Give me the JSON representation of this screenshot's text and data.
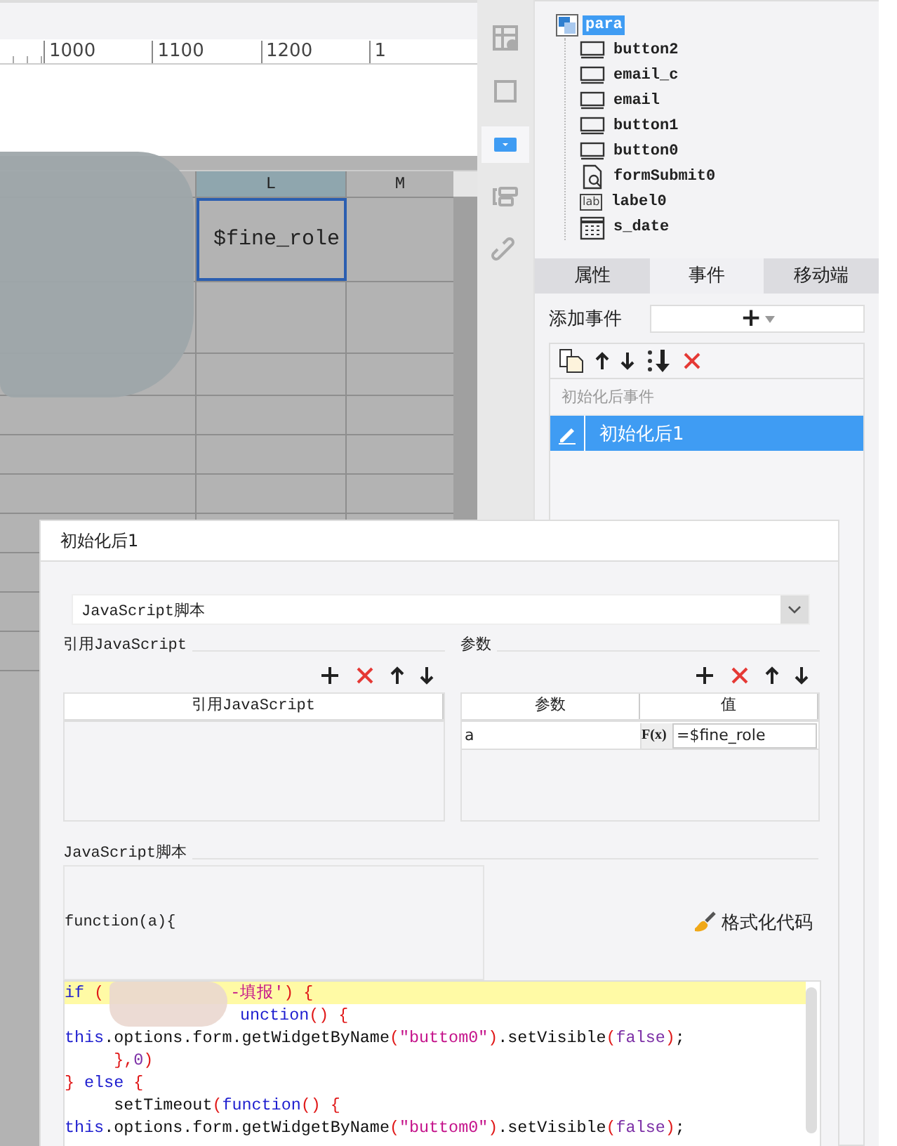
{
  "canvas": {
    "ruler_labels": [
      "1000",
      "1100",
      "1200",
      "1"
    ],
    "columns": [
      {
        "label": "L",
        "selected": true
      },
      {
        "label": "M",
        "selected": false
      }
    ],
    "cell_text": "$fine_role"
  },
  "tools": [
    {
      "kind": "table-info",
      "selected": false
    },
    {
      "kind": "frame",
      "selected": false
    },
    {
      "kind": "dropdown",
      "selected": true
    },
    {
      "kind": "layout",
      "selected": false
    },
    {
      "kind": "link",
      "selected": false
    }
  ],
  "tree": {
    "root": {
      "label": "para",
      "selected": true
    },
    "children": [
      {
        "label": "button2",
        "kind": "button"
      },
      {
        "label": "email_c",
        "kind": "button"
      },
      {
        "label": "email",
        "kind": "button"
      },
      {
        "label": "button1",
        "kind": "button"
      },
      {
        "label": "button0",
        "kind": "button"
      },
      {
        "label": "formSubmit0",
        "kind": "submit"
      },
      {
        "label": "label0",
        "kind": "label",
        "badge": "lab"
      },
      {
        "label": "s_date",
        "kind": "date"
      }
    ]
  },
  "tabs": [
    {
      "label": "属性",
      "selected": false
    },
    {
      "label": "事件",
      "selected": true
    },
    {
      "label": "移动端",
      "selected": false
    }
  ],
  "add_event": {
    "label": "添加事件",
    "button": "+"
  },
  "event_list": {
    "group": "初始化后事件",
    "items": [
      {
        "label": "初始化后1",
        "selected": true
      }
    ]
  },
  "dialog": {
    "title": "初始化后1",
    "script_type": "JavaScript脚本",
    "ref_section": "引用JavaScript",
    "ref_column": "引用JavaScript",
    "param_section": "参数",
    "param_columns": [
      "参数",
      "值"
    ],
    "params": [
      {
        "name": "a",
        "formula_label": "F(x)",
        "value": "=$fine_role"
      }
    ],
    "script_section": "JavaScript脚本",
    "function_header": "function(a){",
    "format_button": "格式化代码",
    "code_lines": [
      {
        "active": true,
        "segments": [
          {
            "kind": "kw",
            "text": "if"
          },
          {
            "kind": "punct",
            "text": " ("
          },
          {
            "kind": "masked"
          },
          {
            "kind": "str",
            "text": "-填报'"
          },
          {
            "kind": "punct",
            "text": ") {"
          }
        ]
      },
      {
        "active": false,
        "segments": [
          {
            "kind": "masked"
          },
          {
            "kind": "kw",
            "text": "unction"
          },
          {
            "kind": "punct",
            "text": "() {"
          }
        ]
      },
      {
        "active": false,
        "segments": [
          {
            "kind": "kw",
            "text": "this"
          },
          {
            "kind": "plain",
            "text": ".options.form.getWidgetByName"
          },
          {
            "kind": "punct",
            "text": "("
          },
          {
            "kind": "str",
            "text": "\"buttom0\""
          },
          {
            "kind": "punct",
            "text": ")"
          },
          {
            "kind": "plain",
            "text": ".setVisible"
          },
          {
            "kind": "punct",
            "text": "("
          },
          {
            "kind": "lit",
            "text": "false"
          },
          {
            "kind": "punct",
            "text": ")"
          },
          {
            "kind": "plain",
            "text": ";"
          }
        ]
      },
      {
        "active": false,
        "segments": [
          {
            "kind": "punct",
            "text": "     },"
          },
          {
            "kind": "lit",
            "text": "0"
          },
          {
            "kind": "punct",
            "text": ")"
          }
        ]
      },
      {
        "active": false,
        "segments": [
          {
            "kind": "punct",
            "text": "}"
          },
          {
            "kind": "kw",
            "text": " else"
          },
          {
            "kind": "punct",
            "text": " {"
          }
        ]
      },
      {
        "active": false,
        "segments": [
          {
            "kind": "plain",
            "text": "     setTimeout"
          },
          {
            "kind": "punct",
            "text": "("
          },
          {
            "kind": "kw",
            "text": "function"
          },
          {
            "kind": "punct",
            "text": "() {"
          }
        ]
      },
      {
        "active": false,
        "segments": [
          {
            "kind": "kw",
            "text": "this"
          },
          {
            "kind": "plain",
            "text": ".options.form.getWidgetByName"
          },
          {
            "kind": "punct",
            "text": "("
          },
          {
            "kind": "str",
            "text": "\"buttom0\""
          },
          {
            "kind": "punct",
            "text": ")"
          },
          {
            "kind": "plain",
            "text": ".setVisible"
          },
          {
            "kind": "punct",
            "text": "("
          },
          {
            "kind": "lit",
            "text": "false"
          },
          {
            "kind": "punct",
            "text": ")"
          },
          {
            "kind": "plain",
            "text": ";"
          }
        ]
      }
    ]
  }
}
